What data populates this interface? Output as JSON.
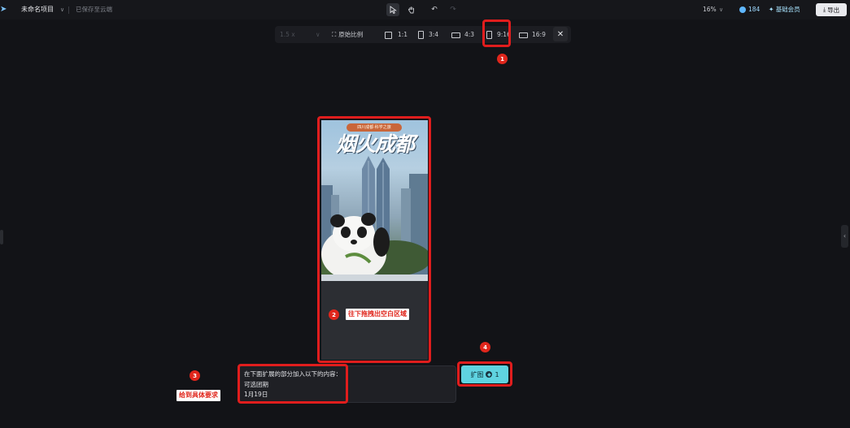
{
  "header": {
    "project_title": "未命名项目",
    "save_status": "已保存至云端",
    "zoom": "16%",
    "credits": "184",
    "membership": "基础会员",
    "export_label": "导出"
  },
  "ratio_toolbar": {
    "scale_value": "1.5 x",
    "original_ratio": "原始比例",
    "ratios": [
      "1:1",
      "3:4",
      "4:3",
      "9:16",
      "16:9"
    ]
  },
  "poster": {
    "banner": "四川成都·科学之旅",
    "title": "烟火成都"
  },
  "prompt": {
    "lines": [
      "在下面扩展的部分加入以下的内容：",
      "可选团期",
      "1月19日"
    ]
  },
  "expand_button": {
    "label": "扩图",
    "cost": "1"
  },
  "annotations": {
    "badges": [
      "1",
      "2",
      "3",
      "4"
    ],
    "drag_hint": "往下拖拽出空白区域",
    "requirement_hint": "给到具体要求"
  },
  "icons": {
    "logo": "logo-icon",
    "select": "cursor-arrow-icon",
    "hand": "hand-icon",
    "undo": "undo-icon",
    "redo": "redo-icon",
    "credits": "credit-coin-icon",
    "vip": "sparkle-icon",
    "export": "download-icon",
    "close": "close-icon"
  },
  "colors": {
    "highlight": "#e01d1d",
    "accent": "#5fd3e0",
    "background": "#121317"
  }
}
